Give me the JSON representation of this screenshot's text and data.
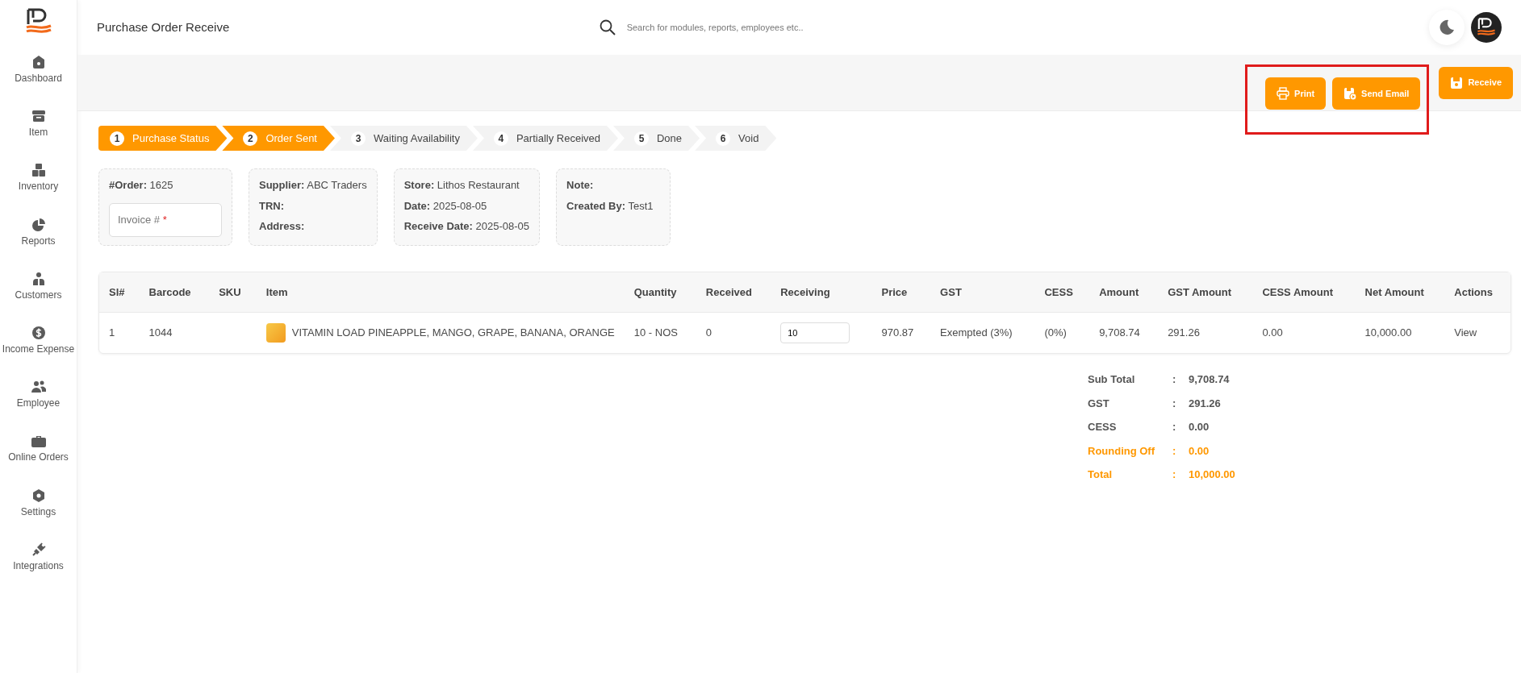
{
  "header": {
    "title": "Purchase Order Receive",
    "search": {
      "placeholder": "Search for modules, reports, employees etc.."
    }
  },
  "sidebar": {
    "items": [
      {
        "label": "Dashboard"
      },
      {
        "label": "Item"
      },
      {
        "label": "Inventory"
      },
      {
        "label": "Reports"
      },
      {
        "label": "Customers"
      },
      {
        "label": "Income Expense"
      },
      {
        "label": "Employee"
      },
      {
        "label": "Online Orders"
      },
      {
        "label": "Settings"
      },
      {
        "label": "Integrations"
      }
    ]
  },
  "toolbar": {
    "buttons": [
      {
        "label": "Print",
        "kind": "print",
        "highlighted": true
      },
      {
        "label": "Send Email",
        "kind": "email",
        "highlighted": true
      },
      {
        "label": "Receive",
        "kind": "receive",
        "highlighted": false
      }
    ]
  },
  "steps": [
    {
      "number": "1",
      "label": "Purchase Status",
      "done": true
    },
    {
      "number": "2",
      "label": "Order Sent",
      "done": true
    },
    {
      "number": "3",
      "label": "Waiting Availability",
      "done": false
    },
    {
      "number": "4",
      "label": "Partially Received",
      "done": false
    },
    {
      "number": "5",
      "label": "Done",
      "done": false
    },
    {
      "number": "6",
      "label": "Void",
      "done": false
    }
  ],
  "info_cards": [
    {
      "fields": [
        {
          "label": "#Order:",
          "value": "1625"
        }
      ],
      "invoice_field": {
        "placeholder": "Invoice #",
        "required_mark": "*"
      }
    },
    {
      "fields": [
        {
          "label": "Supplier:",
          "value": "ABC Traders"
        },
        {
          "label": "TRN:"
        },
        {
          "label": "Address:"
        }
      ]
    },
    {
      "fields": [
        {
          "label": "Store:",
          "value": "Lithos Restaurant"
        },
        {
          "label": "Date:",
          "value": "2025-08-05"
        },
        {
          "label": "Receive Date:",
          "value": "2025-08-05"
        }
      ]
    },
    {
      "fields": [
        {
          "label": "Note:"
        },
        {
          "label": "Created By:",
          "value": "Test1"
        }
      ]
    }
  ],
  "table": {
    "columns": [
      "Sl#",
      "Barcode",
      "SKU",
      "Item",
      "Quantity",
      "Received",
      "Receiving",
      "Price",
      "GST",
      "CESS",
      "Amount",
      "GST Amount",
      "CESS Amount",
      "Net Amount",
      "Actions"
    ],
    "rows": [
      {
        "sl": "1",
        "barcode": "1044",
        "item": "VITAMIN LOAD PINEAPPLE, MANGO, GRAPE, BANANA, ORANGE",
        "quantity": "10 - NOS",
        "received": "0",
        "receiving": "10",
        "price": "970.87",
        "gst": "Exempted (3%)",
        "cess": "(0%)",
        "amount": "9,708.74",
        "gst_amount": "291.26",
        "cess_amount": "0.00",
        "net_amount": "10,000.00",
        "action": "View"
      }
    ]
  },
  "totals": [
    {
      "label": "Sub Total",
      "separator": ":",
      "value": "9,708.74",
      "emphasis": false
    },
    {
      "label": "GST",
      "separator": ":",
      "value": "291.26",
      "emphasis": false
    },
    {
      "label": "CESS",
      "separator": ":",
      "value": "0.00",
      "emphasis": false
    },
    {
      "label": "Rounding Off",
      "separator": ":",
      "value": "0.00",
      "emphasis": true
    },
    {
      "label": "Total",
      "separator": ":",
      "value": "10,000.00",
      "emphasis": true
    }
  ]
}
